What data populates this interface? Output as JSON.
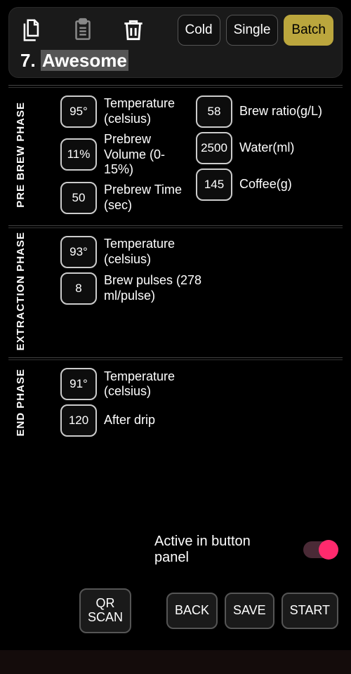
{
  "header": {
    "modes": {
      "cold": "Cold",
      "single": "Single",
      "batch": "Batch",
      "active": "batch"
    },
    "index": "7.",
    "name": "Awesome"
  },
  "sections": {
    "prebrew": {
      "title": "PRE BREW PHASE",
      "temp": {
        "value": "95°",
        "label": "Temperature (celsius)"
      },
      "volume": {
        "value": "11%",
        "label": "Prebrew Volume  (0-15%)"
      },
      "time": {
        "value": "50",
        "label": "Prebrew Time (sec)"
      },
      "ratio": {
        "value": "58",
        "label": "Brew ratio(g/L)"
      },
      "water": {
        "value": "2500",
        "label": "Water(ml)"
      },
      "coffee": {
        "value": "145",
        "label": "Coffee(g)"
      }
    },
    "extraction": {
      "title": "EXTRACTION PHASE",
      "temp": {
        "value": "93°",
        "label": "Temperature (celsius)"
      },
      "pulses": {
        "value": "8",
        "label": "Brew pulses (278 ml/pulse)"
      }
    },
    "end": {
      "title": "END PHASE",
      "temp": {
        "value": "91°",
        "label": "Temperature (celsius)"
      },
      "drip": {
        "value": "120",
        "label": "After drip"
      }
    }
  },
  "activePanel": {
    "label": "Active in button panel",
    "on": true
  },
  "footer": {
    "qr": "QR SCAN",
    "back": "BACK",
    "save": "SAVE",
    "start": "START"
  }
}
